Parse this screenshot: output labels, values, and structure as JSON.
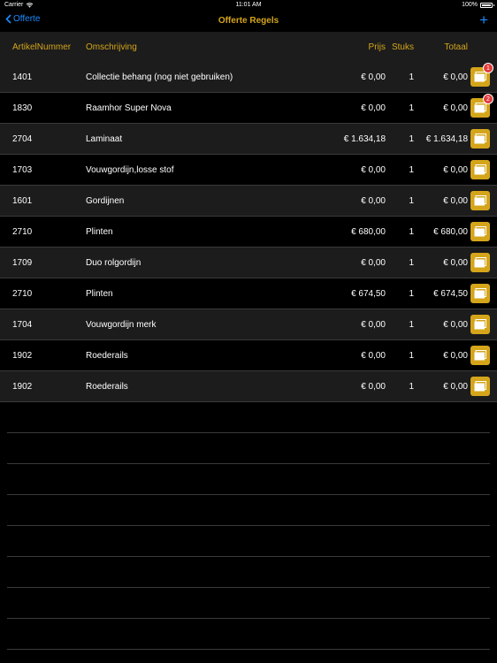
{
  "status": {
    "carrier": "Carrier",
    "time": "11:01 AM",
    "battery": "100%"
  },
  "nav": {
    "back": "Offerte",
    "title": "Offerte Regels",
    "add": "+"
  },
  "columns": {
    "art": "ArtikelNummer",
    "desc": "Omschrijving",
    "prijs": "Prijs",
    "stuks": "Stuks",
    "totaal": "Totaal"
  },
  "rows": [
    {
      "art": "1401",
      "desc": "Collectie behang (nog niet gebruiken)",
      "prijs": "€ 0,00",
      "stuks": "1",
      "totaal": "€ 0,00",
      "badge": "1"
    },
    {
      "art": "1830",
      "desc": "Raamhor Super Nova",
      "prijs": "€ 0,00",
      "stuks": "1",
      "totaal": "€ 0,00",
      "badge": "2"
    },
    {
      "art": "2704",
      "desc": "Laminaat",
      "prijs": "€ 1.634,18",
      "stuks": "1",
      "totaal": "€ 1.634,18",
      "badge": ""
    },
    {
      "art": "1703",
      "desc": "Vouwgordijn,losse stof",
      "prijs": "€ 0,00",
      "stuks": "1",
      "totaal": "€ 0,00",
      "badge": ""
    },
    {
      "art": "1601",
      "desc": "Gordijnen",
      "prijs": "€ 0,00",
      "stuks": "1",
      "totaal": "€ 0,00",
      "badge": ""
    },
    {
      "art": "2710",
      "desc": "Plinten",
      "prijs": "€ 680,00",
      "stuks": "1",
      "totaal": "€ 680,00",
      "badge": ""
    },
    {
      "art": "1709",
      "desc": "Duo rolgordijn",
      "prijs": "€ 0,00",
      "stuks": "1",
      "totaal": "€ 0,00",
      "badge": ""
    },
    {
      "art": "2710",
      "desc": "Plinten",
      "prijs": "€ 674,50",
      "stuks": "1",
      "totaal": "€ 674,50",
      "badge": ""
    },
    {
      "art": "1704",
      "desc": "Vouwgordijn merk",
      "prijs": "€ 0,00",
      "stuks": "1",
      "totaal": "€ 0,00",
      "badge": ""
    },
    {
      "art": "1902",
      "desc": "Roederails",
      "prijs": "€ 0,00",
      "stuks": "1",
      "totaal": "€ 0,00",
      "badge": ""
    },
    {
      "art": "1902",
      "desc": "Roederails",
      "prijs": "€ 0,00",
      "stuks": "1",
      "totaal": "€ 0,00",
      "badge": ""
    }
  ],
  "icons": {
    "row_action": "folder-icon",
    "back": "chevron-left-icon",
    "add": "plus-icon"
  },
  "colors": {
    "accent": "#d4a51a",
    "link": "#1a8cff",
    "badge": "#e23b3b"
  }
}
